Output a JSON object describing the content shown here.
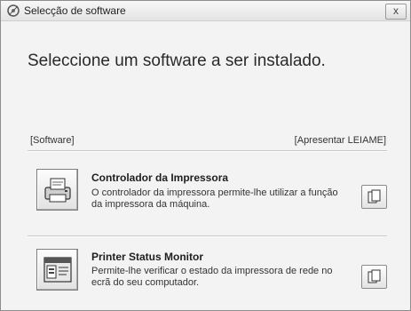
{
  "window": {
    "title": "Selecção de software",
    "close_label": "x"
  },
  "main": {
    "heading": "Seleccione um software a ser instalado.",
    "software_label": "[Software]",
    "readme_label": "[Apresentar LEIAME]"
  },
  "items": [
    {
      "title": "Controlador da Impressora",
      "description": "O controlador da impressora permite-lhe utilizar a função da impressora da máquina.",
      "icon": "printer-icon"
    },
    {
      "title": "Printer Status Monitor",
      "description": "Permite-lhe verificar o estado da impressora de rede no ecrã do seu computador.",
      "icon": "status-monitor-icon"
    }
  ]
}
